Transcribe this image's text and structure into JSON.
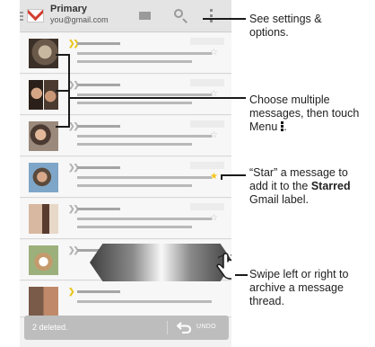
{
  "header": {
    "account_label": "Primary",
    "account_email": "you@gmail.com",
    "icons": [
      "gmail-logo-icon",
      "compose-icon",
      "search-icon",
      "overflow-menu-icon"
    ]
  },
  "messages": [
    {
      "avatar": "photo",
      "marker": "double-chevron",
      "marker_color": "#e8c51a",
      "starred": false
    },
    {
      "avatar": "two-photos",
      "marker": "double-chevron",
      "marker_color": "#b3b3b3",
      "starred": false
    },
    {
      "avatar": "photo",
      "marker": "double-chevron",
      "marker_color": "#b3b3b3",
      "starred": false
    },
    {
      "avatar": "photo",
      "marker": "double-chevron",
      "marker_color": "#b3b3b3",
      "starred": true
    },
    {
      "avatar": "photo",
      "marker": "double-chevron",
      "marker_color": "#b3b3b3",
      "starred": false
    },
    {
      "avatar": "photo",
      "marker": "double-chevron",
      "marker_color": "#b3b3b3",
      "starred": false
    },
    {
      "avatar": "photo",
      "marker": "single-chevron",
      "marker_color": "#e8c51a",
      "starred": false
    }
  ],
  "snackbar": {
    "text": "2 deleted.",
    "undo_label": "UNDO"
  },
  "callouts": {
    "settings": "See settings & options.",
    "multi_select_line1": "Choose multiple",
    "multi_select_line2": "messages, then touch",
    "multi_select_line3": "Menu",
    "star_line1": "“Star” a message to",
    "star_line2": "add it to the",
    "star_bold": "Starred",
    "star_line3": "Gmail label.",
    "swipe_line1": "Swipe left or right to",
    "swipe_line2": "archive a message",
    "swipe_line3": "thread."
  },
  "colors": {
    "star_active": "#f5c418",
    "important_marker": "#e8c51a",
    "gmail_red": "#d23f31"
  }
}
